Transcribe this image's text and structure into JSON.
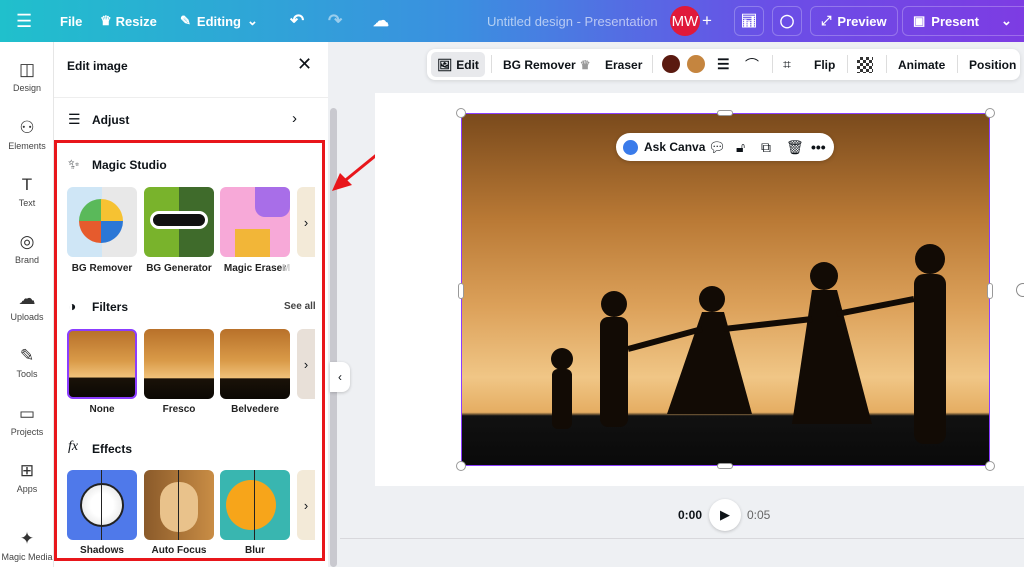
{
  "topbar": {
    "menu_icon": "hamburger-icon",
    "file": "File",
    "resize": "Resize",
    "editing": "Editing",
    "title": "Untitled design - Presentation",
    "avatar": "MW",
    "preview": "Preview",
    "present": "Present"
  },
  "rail": [
    {
      "label": "Design",
      "icon": "design-icon"
    },
    {
      "label": "Elements",
      "icon": "elements-icon"
    },
    {
      "label": "Text",
      "icon": "text-icon"
    },
    {
      "label": "Brand",
      "icon": "brand-icon"
    },
    {
      "label": "Uploads",
      "icon": "uploads-icon"
    },
    {
      "label": "Tools",
      "icon": "tools-icon"
    },
    {
      "label": "Projects",
      "icon": "projects-icon"
    },
    {
      "label": "Apps",
      "icon": "apps-icon"
    },
    {
      "label": "Magic Media",
      "icon": "magic-media-icon"
    }
  ],
  "panel": {
    "title": "Edit image",
    "adjust": "Adjust",
    "magic": {
      "title": "Magic Studio",
      "items": [
        "BG Remover",
        "BG Generator",
        "Magic Eraser"
      ],
      "partial": "M"
    },
    "filters": {
      "title": "Filters",
      "see_all": "See all",
      "items": [
        "None",
        "Fresco",
        "Belvedere"
      ],
      "selected": "None"
    },
    "effects": {
      "title": "Effects",
      "icon_text": "fx",
      "items": [
        "Shadows",
        "Auto Focus",
        "Blur"
      ]
    }
  },
  "toolbar": {
    "edit": "Edit",
    "bg_remover": "BG Remover",
    "eraser": "Eraser",
    "colors": [
      "#5a1a10",
      "#c5853f"
    ],
    "flip": "Flip",
    "animate": "Animate",
    "position": "Position"
  },
  "canvas": {
    "ask_canva": "Ask Canva"
  },
  "timeline": {
    "current": "0:00",
    "total": "0:05"
  },
  "colors": {
    "accent": "#8b3dff",
    "highlight": "#e8161b"
  }
}
